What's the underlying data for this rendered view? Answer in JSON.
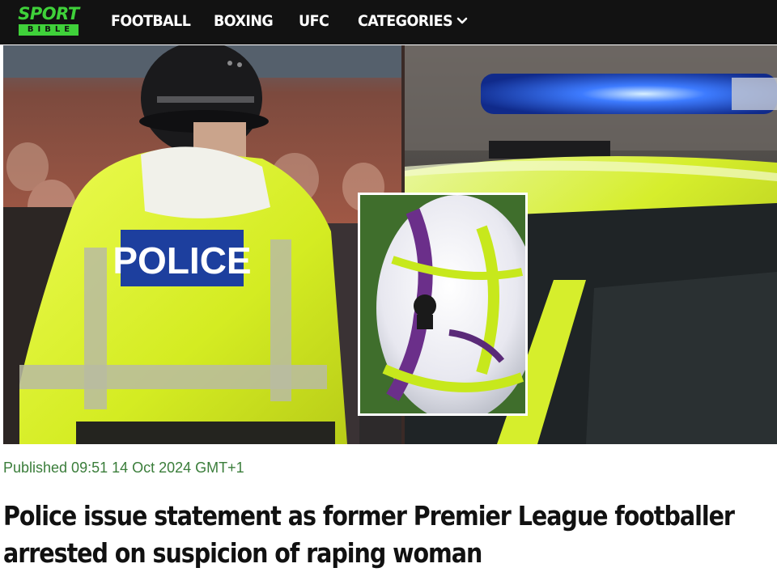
{
  "header": {
    "logo": {
      "top": "SPORT",
      "bottom": "BIBLE"
    },
    "nav": [
      {
        "label": "FOOTBALL"
      },
      {
        "label": "BOXING"
      },
      {
        "label": "UFC"
      },
      {
        "label": "CATEGORIES"
      }
    ],
    "categories_icon": "chevron-down-icon"
  },
  "hero": {
    "vest_text": "POLICE"
  },
  "article": {
    "published": "Published 09:51 14 Oct 2024 GMT+1",
    "headline_line1": "Police issue statement as former Premier League footballer",
    "headline_line2": "arrested on suspicion of raping woman"
  },
  "colors": {
    "brand_green": "#3fd13a",
    "nav_background": "#121212",
    "published_text": "#3a7d3a",
    "hi_vis_yellow": "#d9f21a",
    "police_blue": "#1d3f9e"
  }
}
